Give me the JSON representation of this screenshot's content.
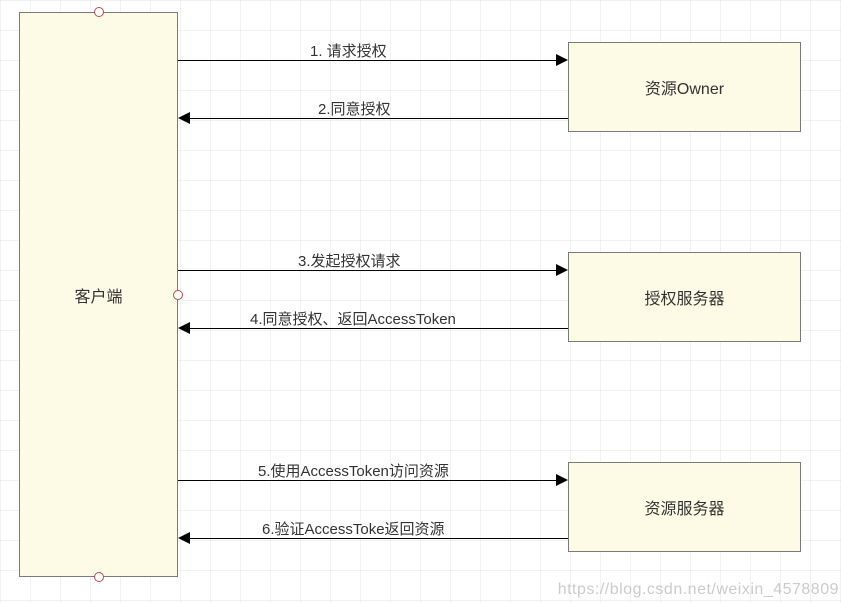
{
  "nodes": {
    "client": "客户端",
    "resource_owner": "资源Owner",
    "auth_server": "授权服务器",
    "resource_server": "资源服务器"
  },
  "arrows": {
    "a1": "1. 请求授权",
    "a2": "2.同意授权",
    "a3": "3.发起授权请求",
    "a4": "4.同意授权、返回AccessToken",
    "a5": "5.使用AccessToken访问资源",
    "a6": "6.验证AccessToke返回资源"
  },
  "watermark": "https://blog.csdn.net/weixin_4578809"
}
